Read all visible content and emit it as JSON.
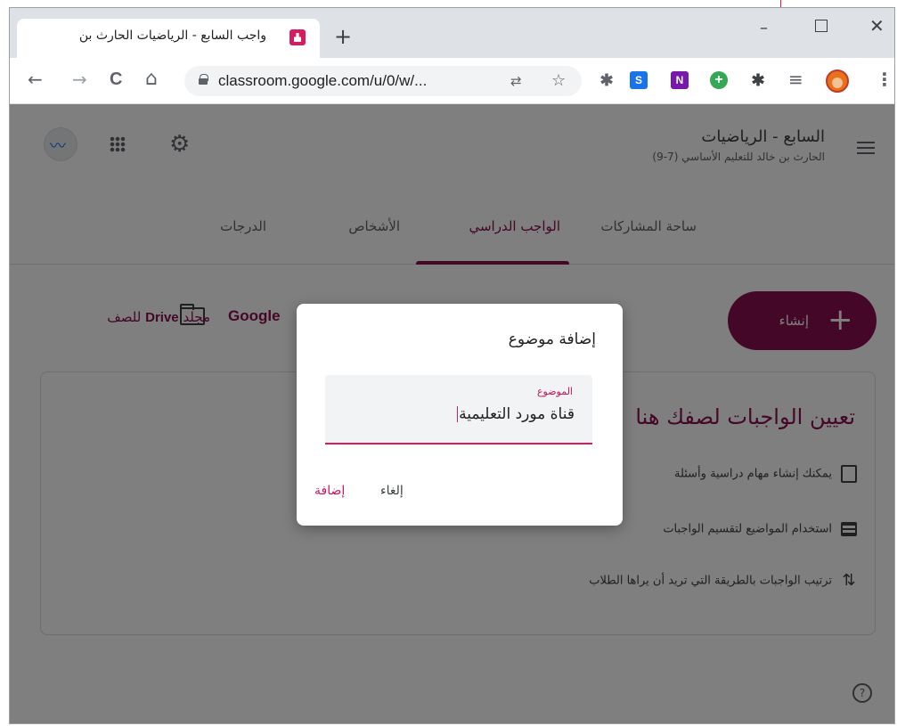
{
  "browser": {
    "tab_title": "واجب السابع - الرياضيات الحارث بن",
    "tab_close": "×",
    "new_tab": "+",
    "min": "–",
    "close": "✕",
    "url": "classroom.google.com/u/0/w/...",
    "nav": {
      "back": "←",
      "forward": "→",
      "reload": "C",
      "home": "⌂"
    },
    "omnibox_icons": {
      "translate": "⇄",
      "star": "☆"
    },
    "extensions": [
      {
        "name": "puzzle-extension",
        "label": "✱",
        "color": "#5f6368"
      },
      {
        "name": "sway-extension",
        "label": "S",
        "color": "#1a73e8"
      },
      {
        "name": "onenote-extension",
        "label": "N",
        "color": "#7719aa"
      },
      {
        "name": "plus-extension",
        "label": "+",
        "color": "#34a853"
      },
      {
        "name": "extensions-menu",
        "label": "✱",
        "color": "#3c4043"
      }
    ],
    "reading_list": "≡",
    "menu": "⋮"
  },
  "course": {
    "title": "السابع - الرياضيات",
    "subtitle": "الحارث بن خالد للتعليم الأساسي (7-9)"
  },
  "nav_tabs": [
    {
      "label": "ساحة المشاركات",
      "active": false
    },
    {
      "label": "الواجب الدراسي",
      "active": true
    },
    {
      "label": "الأشخاص",
      "active": false
    },
    {
      "label": "الدرجات",
      "active": false
    }
  ],
  "toolbar": {
    "create_label": "إنشاء",
    "create_plus": "+",
    "google_calendar": "Google",
    "drive_prefix": "مجلد",
    "drive_brand": "Drive",
    "drive_suffix": "للصف"
  },
  "empty_card": {
    "title": "تعيين الواجبات لصفك هنا",
    "rows": [
      {
        "icon": "assignment-icon",
        "text": "يمكنك إنشاء مهام دراسية وأسئلة"
      },
      {
        "icon": "list-icon",
        "text": "استخدام المواضيع لتقسيم الواجبات"
      },
      {
        "icon": "sort-icon",
        "text": "ترتيب الواجبات بالطريقة التي تريد أن يراها الطلاب"
      }
    ],
    "help": "?"
  },
  "dialog": {
    "title": "إضافة موضوع",
    "field_label": "الموضوع",
    "field_value": "قناة مورد التعليمية",
    "cancel_label": "إلغاء",
    "add_label": "إضافة"
  },
  "colors": {
    "accent": "#880e4f",
    "focus": "#d81b60"
  }
}
